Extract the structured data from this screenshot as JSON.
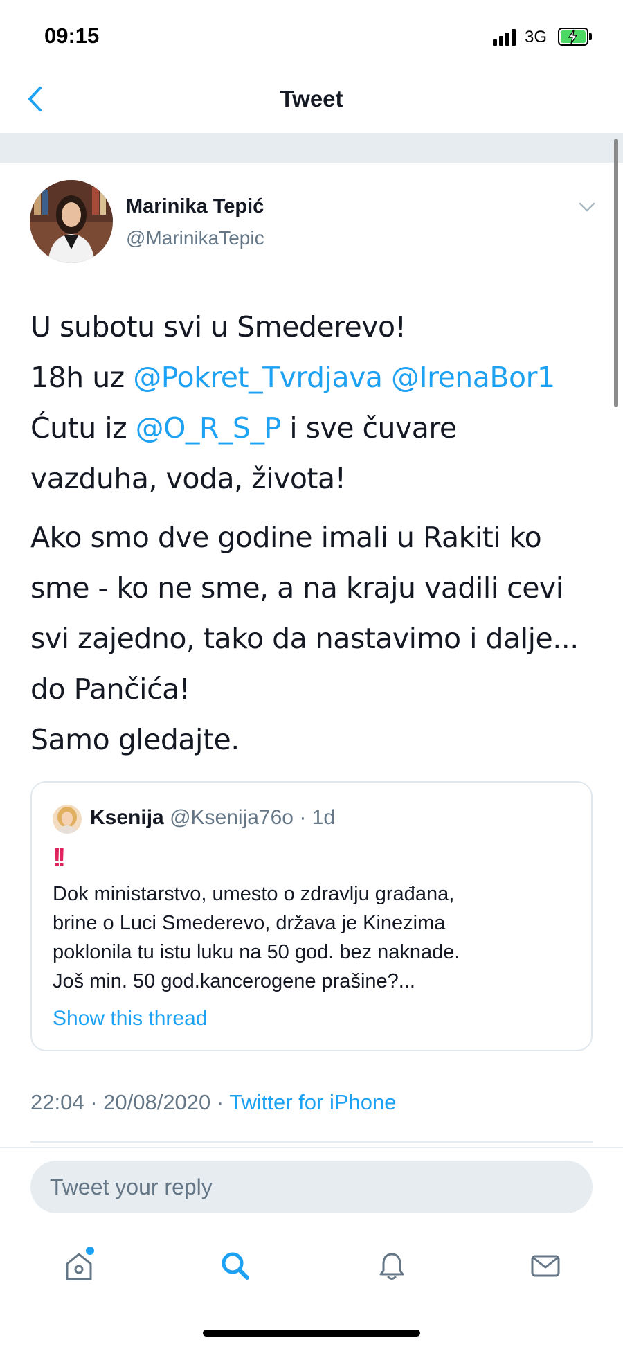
{
  "status_bar": {
    "time": "09:15",
    "network": "3G",
    "battery": "charging"
  },
  "nav": {
    "title": "Tweet",
    "back_icon": "chevron-left-icon"
  },
  "tweet": {
    "author": {
      "name": "Marinika Tepić",
      "handle": "@MarinikaTepic"
    },
    "paragraph_1": {
      "text_1": "U subotu svi u Smederevo!",
      "text_2": "18h uz ",
      "mention_1": "@Pokret_Tvrdjava",
      "mention_2": "@IrenaBor1",
      "text_3": "Ćutu iz ",
      "mention_3": "@O_R_S_P",
      "text_4": " i sve čuvare",
      "text_5": "vazduha, voda, života!"
    },
    "paragraph_2": {
      "line_1": "Ako smo dve godine imali u Rakiti ko",
      "line_2": "sme - ko ne sme, a na kraju vadili cevi",
      "line_3": "svi zajedno, tako da nastavimo i dalje...",
      "line_4": "do Pančića!",
      "line_5": "Samo gledajte."
    },
    "quoted": {
      "name": "Ksenija",
      "handle": "@Ksenija76o",
      "time": "· 1d",
      "emoji": "!!",
      "line_1": "Dok ministarstvo, umesto o zdravlju građana,",
      "line_2": "brine o Luci Smederevo, država je Kinezima",
      "line_3": "poklonila tu istu luku na 50 god. bez naknade.",
      "line_4": "Još min. 50 god.kancerogene prašine?...",
      "show_thread": "Show this thread"
    },
    "timestamp": "22:04 · 20/08/2020 · ",
    "source": "Twitter for iPhone"
  },
  "reply": {
    "placeholder": "Tweet your reply"
  },
  "tab_bar": {
    "items": [
      {
        "icon": "home-icon",
        "active": false,
        "has_badge": true
      },
      {
        "icon": "search-icon",
        "active": true
      },
      {
        "icon": "bell-icon",
        "active": false
      },
      {
        "icon": "mail-icon",
        "active": false
      }
    ]
  },
  "colors": {
    "accent": "#1da1f2",
    "text": "#141823",
    "secondary": "#657786",
    "band": "#e6ecf0"
  }
}
